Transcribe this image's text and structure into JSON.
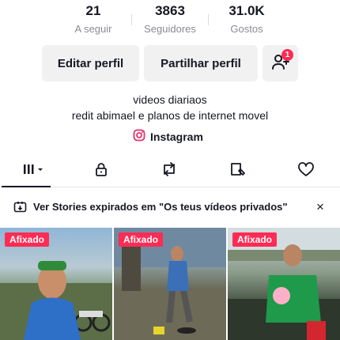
{
  "stats": [
    {
      "value": "21",
      "label": "A seguir"
    },
    {
      "value": "3863",
      "label": "Seguidores"
    },
    {
      "value": "31.0K",
      "label": "Gostos"
    }
  ],
  "actions": {
    "edit_label": "Editar perfil",
    "share_label": "Partilhar perfil",
    "friend_icon": "add-friend-icon",
    "friend_badge": "1"
  },
  "bio": {
    "line1": "videos diariaos",
    "line2": "redit abimael e planos de internet movel",
    "link_label": "Instagram"
  },
  "tabs": [
    {
      "icon": "grid-icon",
      "active": true
    },
    {
      "icon": "lock-icon"
    },
    {
      "icon": "repost-icon"
    },
    {
      "icon": "saved-icon"
    },
    {
      "icon": "heart-icon"
    }
  ],
  "banner": {
    "text": "Ver Stories expirados em \"Os teus vídeos privados\"",
    "close": "×"
  },
  "videos": [
    {
      "badge": "Afixado",
      "caption": ""
    },
    {
      "badge": "Afixado",
      "caption": ""
    },
    {
      "badge": "Afixado",
      "caption": ""
    }
  ],
  "colors": {
    "accent": "#fe2c55",
    "text": "#161823",
    "muted": "#8a8b91",
    "button_bg": "#f1f1f2"
  }
}
